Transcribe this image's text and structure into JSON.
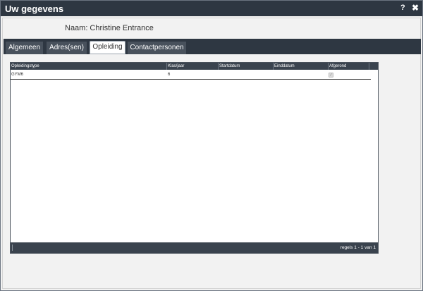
{
  "window": {
    "title": "Uw gegevens",
    "help_label": "?",
    "close_label": "✖"
  },
  "person": {
    "name_label": "Naam:",
    "name_value": "Christine Entrance"
  },
  "tabs": [
    {
      "label": "Algemeen",
      "active": false
    },
    {
      "label": "Adres(sen)",
      "active": false
    },
    {
      "label": "Opleiding",
      "active": true
    },
    {
      "label": "Contactpersonen",
      "active": false
    }
  ],
  "grid": {
    "columns": [
      "Opleidingstype",
      "Klas/jaar",
      "Startdatum",
      "Einddatum",
      "Afgerond"
    ],
    "rows": [
      {
        "opleidingstype": "GYM6",
        "klas_jaar": "6",
        "startdatum": "",
        "einddatum": "",
        "afgerond": true
      }
    ],
    "paging_text": "regels 1 - 1 van 1"
  }
}
